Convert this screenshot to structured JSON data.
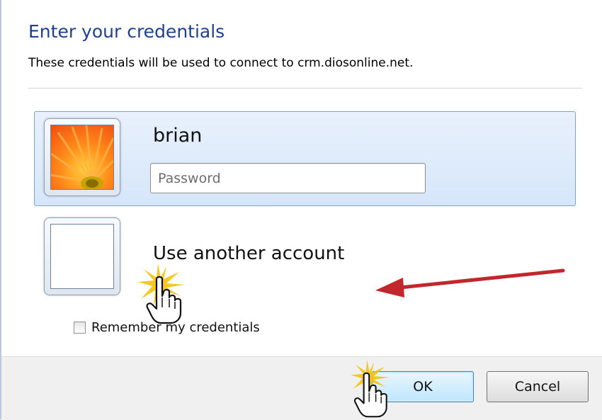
{
  "dialog": {
    "title": "Enter your credentials",
    "subtitle": "These credentials will be used to connect to crm.diosonline.net."
  },
  "account_tiles": [
    {
      "username": "brian",
      "password_placeholder": "Password",
      "password_value": ""
    },
    {
      "label": "Use another account"
    }
  ],
  "remember": {
    "label": "Remember my credentials",
    "checked": false
  },
  "buttons": {
    "ok": "OK",
    "cancel": "Cancel"
  },
  "colors": {
    "title": "#1f3f8f",
    "tile_selected_bg": "#dbe8f9",
    "tile_selected_border": "#7da2ce",
    "annotation_arrow": "#c1272d",
    "click_burst": "#f4c20d"
  },
  "icons": [
    "user-avatar-flower-icon",
    "blank-avatar-icon",
    "hand-cursor-icon",
    "click-burst-icon",
    "red-arrow-icon"
  ]
}
